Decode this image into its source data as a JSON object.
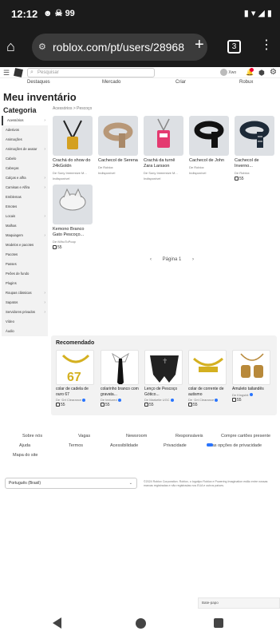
{
  "status": {
    "time": "12:12",
    "notif": "99"
  },
  "browser": {
    "url": "roblox.com/pt/users/28968",
    "tab_count": "3"
  },
  "topbar": {
    "search_placeholder": "Pesquisar",
    "username": "Xwo"
  },
  "nav": [
    "Destaques",
    "Mercado",
    "Criar",
    "Robux"
  ],
  "page": {
    "title": "Meu inventário",
    "category_heading": "Categoria",
    "breadcrumb": "Acessórios > Pescoço"
  },
  "categories": [
    "Acessórios",
    "Adesivos",
    "Animações",
    "Animações de avatar",
    "Cabelo",
    "Cabeças",
    "Calças e alfra",
    "Camisas e Alfira",
    "Emblemas",
    "Emotes",
    "Locais",
    "Malhas",
    "Maquiagem",
    "Modelos e pacotes",
    "Pacotes",
    "Passes",
    "Peões de fundo",
    "Plugins",
    "Roupas clássicas",
    "Sapatos",
    "Servidores privados",
    "Vídeo",
    "Áudio"
  ],
  "items": [
    {
      "name": "Crachá do show do 24kGoldn",
      "by": "De Sony Immersive M...",
      "status": "Indisponível"
    },
    {
      "name": "Cachecol de Serena",
      "by": "De Roblox",
      "status": "Indisponível"
    },
    {
      "name": "Crachá da turnê Zara Larsson",
      "by": "De Sony Immersive M...",
      "status": "Indisponível"
    },
    {
      "name": "Cachecol de John",
      "by": "De Roblox",
      "status": "Indisponível"
    },
    {
      "name": "Cachecol de Inverno...",
      "by": "De Roblox",
      "price": "55"
    },
    {
      "name": "Kemono Branco Gato Pescoço...",
      "by": "De iWhoToPoop",
      "price": "55"
    }
  ],
  "pager": {
    "label": "Página 1"
  },
  "recommended": {
    "title": "Recomendado",
    "items": [
      {
        "name": "colar de cadela de ouro 67",
        "by": "De ·Drt Clearance",
        "price": "55"
      },
      {
        "name": "colarinho branco com gravata...",
        "by": "De textured",
        "price": "55"
      },
      {
        "name": "Lenço de Pescoço Gótico...",
        "by": "De Marketle UGC",
        "price": "55"
      },
      {
        "name": "colar de corrente de autismo",
        "by": "De ·Drt Clearance",
        "price": "55"
      },
      {
        "name": "Amuleto tailandês",
        "by": "De Kingsbit",
        "price": "55"
      }
    ]
  },
  "footer": {
    "links": [
      "Sobre nós",
      "Vagas",
      "Newsroom",
      "Responsáveis",
      "Compre cartões presente",
      "Ajuda",
      "Termos",
      "Acessibilidade",
      "Privacidade",
      "Suas opções de privacidade",
      "Mapa do site"
    ],
    "language": "Português (Brasil)",
    "copyright": "©2024 Roblox Corporation. Roblox, o logotipo Roblox e Powering Imagination estão entre nossas marcas registradas e não registradas nos EUA e outros países."
  },
  "chat": {
    "label": "Bate-papo"
  }
}
